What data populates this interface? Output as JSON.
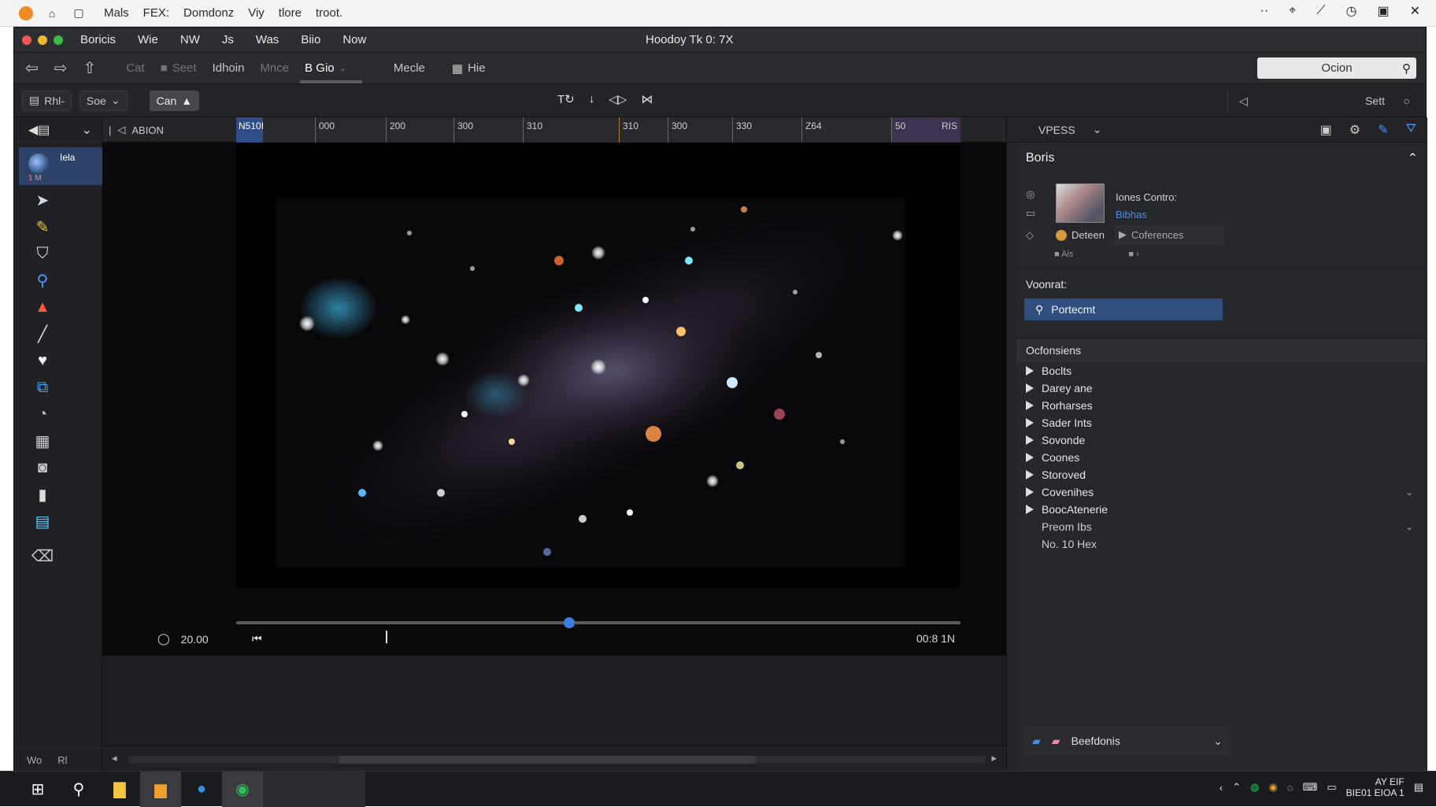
{
  "os_bar": {
    "menu": [
      "Mals",
      "FEX:",
      "Domdonz",
      "Viy",
      "tlore",
      "troot."
    ],
    "right_icons": [
      "more-icon",
      "pin-icon",
      "edit-icon",
      "clock-icon",
      "save-icon",
      "close-icon"
    ]
  },
  "window": {
    "title": "Hoodoy Tk 0: 7X",
    "menu": [
      "Boricis",
      "Wie",
      "NW",
      "Js",
      "Was",
      "Biio",
      "Now"
    ]
  },
  "toolbar1": {
    "items": [
      {
        "label": "Cat",
        "state": "dim"
      },
      {
        "label": "Seet",
        "state": "dim"
      },
      {
        "label": "Idhoin",
        "state": "normal"
      },
      {
        "label": "Mnce",
        "state": "dim"
      },
      {
        "label": "B Gio",
        "state": "active"
      },
      {
        "label": "Mecle",
        "state": "normal"
      },
      {
        "label": "Hie",
        "state": "normal"
      }
    ],
    "search": "Ocion"
  },
  "toolbar2": {
    "btn1": "Rhl-",
    "btn2": "Soe",
    "btn3": "Can",
    "right_label": "Sett"
  },
  "leftbar": {
    "head_icon": "speaker-icon",
    "selected": {
      "title": "Iela",
      "sub": "1 M"
    },
    "icons": [
      "tag-icon",
      "pencil-icon",
      "bucket-icon",
      "magnify-icon",
      "mountain-icon",
      "line-icon",
      "heart-icon",
      "code-icon",
      "compass-icon",
      "grid-icon",
      "camera-icon",
      "page-icon",
      "table-icon",
      "brush-icon"
    ],
    "foot": [
      "Wo",
      "Rl"
    ]
  },
  "timeline": {
    "label": "ABION",
    "ticks": [
      "N510I",
      "000",
      "200",
      "300",
      "310",
      "310",
      "300",
      "330",
      "Z64",
      "50",
      "RIS"
    ]
  },
  "player": {
    "time_left": "20.00",
    "time_right": "00:8 1N",
    "progress": 0.46
  },
  "right_panel": {
    "dropdown": "VPESS",
    "section_title": "Boris",
    "doc": {
      "title": "Iones Contro:",
      "link": "Bibhas",
      "label2": "Deteen",
      "label3": "Coferences",
      "foot": [
        "Ais",
        ""
      ]
    },
    "voice_label": "Voonrat:",
    "voice_value": "Portecmt",
    "categories_title": "Ocfonsiens",
    "categories": [
      "Boclts",
      "Darey ane",
      "Rorharses",
      "Sader Ints",
      "Sovonde",
      "Coones",
      "Storoved",
      "Covenihes",
      "BoocAtenerie"
    ],
    "subitems": [
      "Preom Ibs",
      "No. 10 Hex"
    ],
    "bottom": "Beefdonis"
  },
  "taskbar": {
    "clock_time": "AY EIF",
    "clock_date": "BIE01 EIOA 1"
  }
}
